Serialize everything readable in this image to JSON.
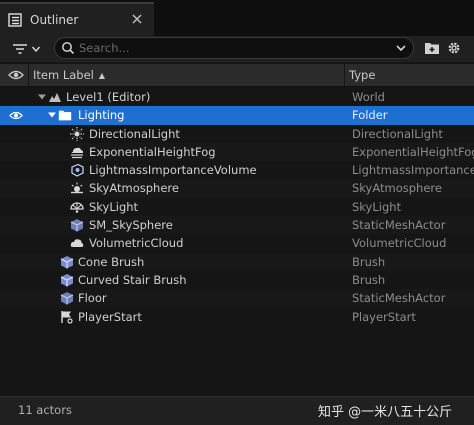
{
  "tab": {
    "title": "Outliner",
    "icon": "outliner-icon"
  },
  "toolbar": {
    "search_placeholder": "Search...",
    "filter_icon": "filter-icon",
    "add_folder_icon": "add-folder-icon",
    "settings_icon": "gear-icon"
  },
  "columns": {
    "label": "Item Label",
    "sort": "▲",
    "type": "Type"
  },
  "rows": [
    {
      "label": "Level1 (Editor)",
      "type": "World",
      "depth": 0,
      "icon": "level-icon",
      "expanded": true,
      "eye": false,
      "selected": false
    },
    {
      "label": "Lighting",
      "type": "Folder",
      "depth": 1,
      "icon": "folder-icon",
      "expanded": true,
      "eye": true,
      "selected": true
    },
    {
      "label": "DirectionalLight",
      "type": "DirectionalLight",
      "depth": 2,
      "icon": "directional-light-icon"
    },
    {
      "label": "ExponentialHeightFog",
      "type": "ExponentialHeightFog",
      "depth": 2,
      "icon": "fog-icon"
    },
    {
      "label": "LightmassImportanceVolume",
      "type": "LightmassImportanceV",
      "depth": 2,
      "icon": "volume-icon"
    },
    {
      "label": "SkyAtmosphere",
      "type": "SkyAtmosphere",
      "depth": 2,
      "icon": "sky-atmosphere-icon"
    },
    {
      "label": "SkyLight",
      "type": "SkyLight",
      "depth": 2,
      "icon": "sky-light-icon"
    },
    {
      "label": "SM_SkySphere",
      "type": "StaticMeshActor",
      "depth": 2,
      "icon": "static-mesh-icon"
    },
    {
      "label": "VolumetricCloud",
      "type": "VolumetricCloud",
      "depth": 2,
      "icon": "cloud-icon"
    },
    {
      "label": "Cone Brush",
      "type": "Brush",
      "depth": 1,
      "icon": "brush-icon"
    },
    {
      "label": "Curved Stair Brush",
      "type": "Brush",
      "depth": 1,
      "icon": "brush-icon"
    },
    {
      "label": "Floor",
      "type": "StaticMeshActor",
      "depth": 1,
      "icon": "static-mesh-icon"
    },
    {
      "label": "PlayerStart",
      "type": "PlayerStart",
      "depth": 1,
      "icon": "player-start-icon"
    }
  ],
  "footer": {
    "count": "11 actors",
    "watermark": "知乎 @一米八五十公斤"
  },
  "colors": {
    "selected": "#1e6fcf",
    "background": "#151515"
  }
}
